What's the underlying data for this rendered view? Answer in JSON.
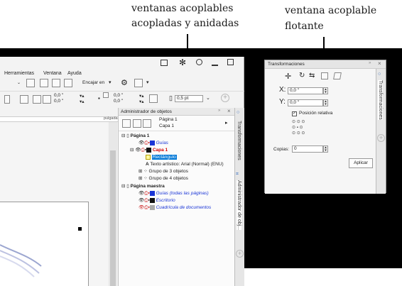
{
  "captions": {
    "docked": [
      "ventanas acoplables",
      "acopladas y anidadas"
    ],
    "floating": [
      "ventana acoplable",
      "flotante"
    ]
  },
  "menu": {
    "herramientas": "Herramientas",
    "ventana": "Ventana",
    "ayuda": "Ayuda"
  },
  "toolbar": {
    "snap_label": "Encajar en",
    "x_val": "0,0 \"",
    "y_val": "0,0 \"",
    "w_val": "0,0 \"",
    "h_val": "0,0 \"",
    "outline_val": "0,5 pt"
  },
  "ruler": {
    "unit": "pulgadas"
  },
  "object_manager": {
    "title": "Administrador de objetos",
    "current_page": "Página 1",
    "current_layer": "Capa 1",
    "page1": "Página 1",
    "guides": "Guías",
    "layer1": "Capa 1",
    "rect": "Rectángulo",
    "artistic_text": "Texto artístico: Arial (Normal) (ENU)",
    "group3": "Grupo de 3 objetos",
    "group4": "Grupo de 4 objetos",
    "master": "Página maestra",
    "guides_all": "Guías (todas las páginas)",
    "desktop": "Escritorio",
    "grid": "Cuadrícula de documentos"
  },
  "dock_tabs": {
    "transform": "Transformaciones",
    "obj_manager": "Administrador de obj..."
  },
  "transform": {
    "title": "Transformaciones",
    "x_label": "X:",
    "x_value": "0,0 \"",
    "y_label": "Y:",
    "y_value": "0,0 \"",
    "relative": "Posición relativa",
    "copies_label": "Copias:",
    "copies_value": "0",
    "apply": "Aplicar"
  },
  "colors": {
    "accent": "#0a6cd6",
    "layer_red": "#d40000",
    "selection": "#0078d7"
  }
}
